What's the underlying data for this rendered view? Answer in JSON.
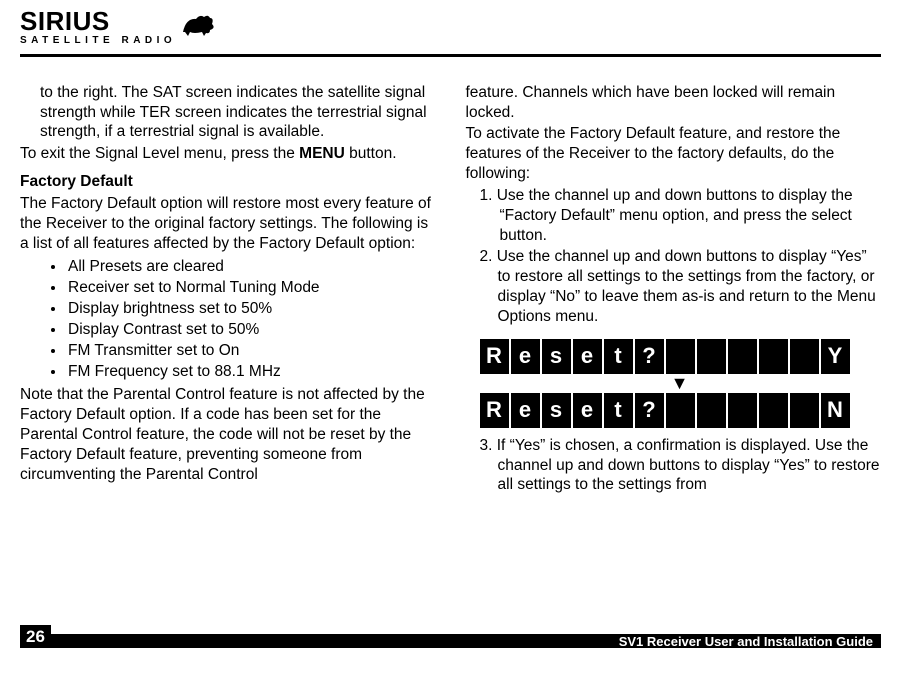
{
  "brand": {
    "name": "SIRIUS",
    "tagline": "SATELLITE RADIO"
  },
  "left": {
    "p1": "to the right. The SAT screen indicates the satellite signal strength while TER screen indicates the terrestrial signal strength, if a terrestrial signal is available.",
    "p2a": "To exit the Signal Level menu, press the ",
    "p2b": "MENU",
    "p2c": " button.",
    "h1": "Factory Default",
    "p3": "The Factory Default option will restore most every feature of the Receiver to the original factory settings. The following is a list of all features affected by the Factory Default option:",
    "bullets": [
      "All Presets are cleared",
      "Receiver set to Normal Tuning Mode",
      "Display brightness set to 50%",
      "Display Contrast set to 50%",
      "FM Transmitter set to On",
      "FM Frequency set to 88.1 MHz"
    ],
    "p4": "Note that the Parental Control feature is not affected by the Factory Default option. If a code has been set for the Parental Control feature, the code will not be reset by the Factory Default feature, preventing someone from circumventing the Parental Control"
  },
  "right": {
    "p1": "feature. Channels which have been locked will remain locked.",
    "p2": "To activate the Factory Default feature, and restore the features of the Receiver to the factory defaults, do the following:",
    "n1": "1. Use the channel up and down buttons to display the “Factory Default” menu option, and press the select button.",
    "n2": "2. Use the channel up and down buttons to display “Yes” to restore all settings to the settings from the factory, or display “No” to leave them as-is and return to the Menu Options menu.",
    "lcd_row1": [
      "R",
      "e",
      "s",
      "e",
      "t",
      "?",
      "",
      "",
      "",
      "",
      "",
      "Y"
    ],
    "lcd_row2": [
      "R",
      "e",
      "s",
      "e",
      "t",
      "?",
      "",
      "",
      "",
      "",
      "",
      "N"
    ],
    "n3": "3. If “Yes” is chosen, a confirmation is displayed. Use the channel up and down buttons to display “Yes” to restore all settings to the settings from"
  },
  "footer": {
    "pagenum": "26",
    "title": "SV1 Receiver User and Installation Guide"
  }
}
